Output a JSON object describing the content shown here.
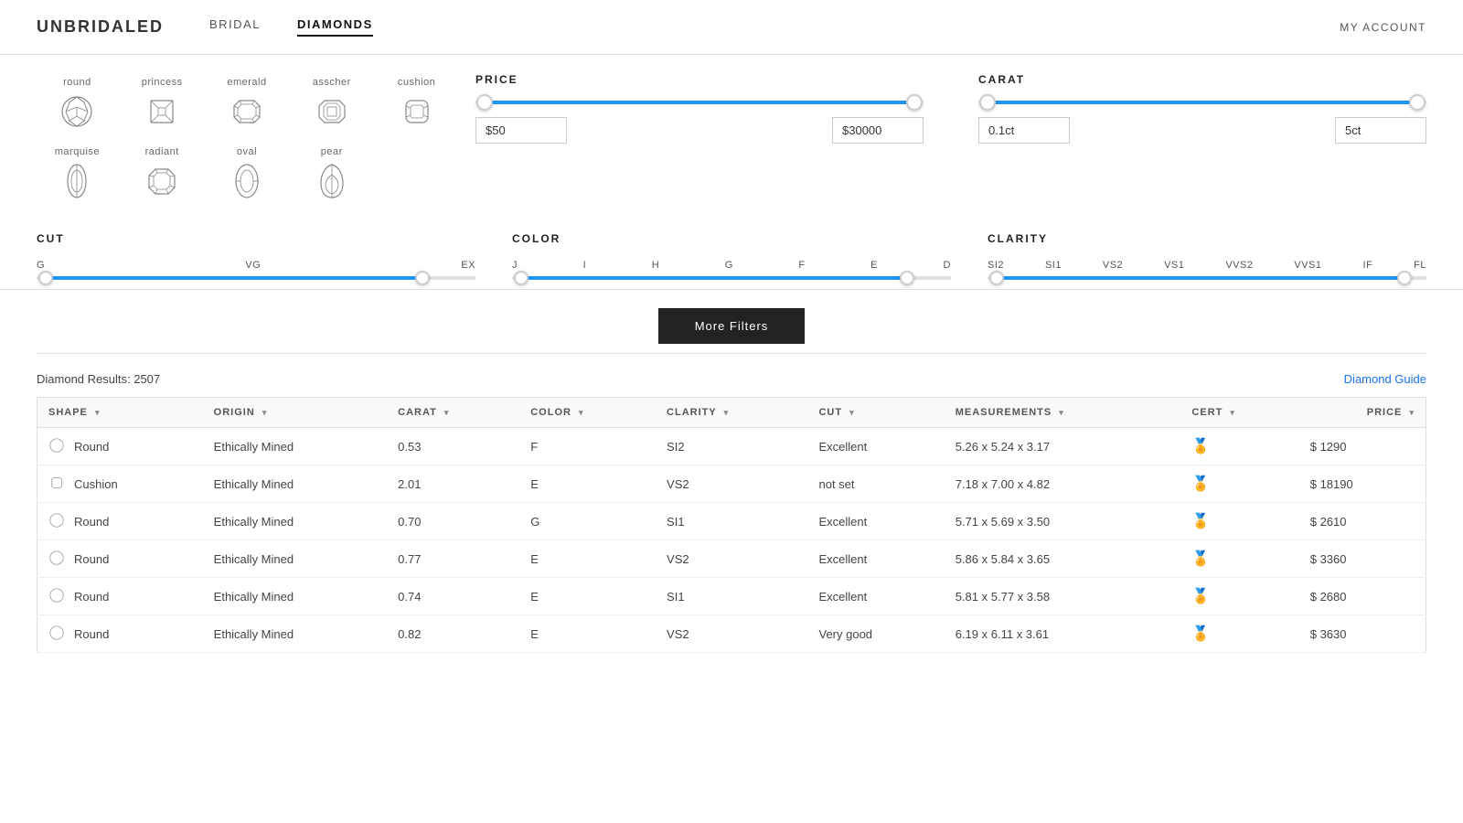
{
  "header": {
    "logo": "UNBRIDALED",
    "nav": [
      {
        "label": "BRIDAL",
        "active": false
      },
      {
        "label": "DIAMONDS",
        "active": true
      }
    ],
    "my_account": "MY ACCOUNT"
  },
  "shapes": [
    {
      "label": "round",
      "id": "round"
    },
    {
      "label": "princess",
      "id": "princess"
    },
    {
      "label": "emerald",
      "id": "emerald"
    },
    {
      "label": "asscher",
      "id": "asscher"
    },
    {
      "label": "cushion",
      "id": "cushion"
    },
    {
      "label": "marquise",
      "id": "marquise"
    },
    {
      "label": "radiant",
      "id": "radiant"
    },
    {
      "label": "oval",
      "id": "oval"
    },
    {
      "label": "pear",
      "id": "pear"
    }
  ],
  "price_filter": {
    "title": "PRICE",
    "min_value": "$50",
    "max_value": "$30000",
    "fill_left": "2%",
    "fill_right": "2%",
    "thumb_left_pct": 2,
    "thumb_right_pct": 98
  },
  "carat_filter": {
    "title": "CARAT",
    "min_value": "0.1ct",
    "max_value": "5ct",
    "fill_left": "2%",
    "fill_right": "2%",
    "thumb_left_pct": 2,
    "thumb_right_pct": 98
  },
  "cut_filter": {
    "title": "CUT",
    "labels": [
      "G",
      "VG",
      "EX"
    ],
    "thumb_left_pct": 2,
    "thumb_right_pct": 88
  },
  "color_filter": {
    "title": "COLOR",
    "labels": [
      "J",
      "I",
      "H",
      "G",
      "F",
      "E",
      "D"
    ],
    "thumb_left_pct": 2,
    "thumb_right_pct": 90
  },
  "clarity_filter": {
    "title": "CLARITY",
    "labels": [
      "SI2",
      "SI1",
      "VS2",
      "VS1",
      "VVS2",
      "VVS1",
      "IF",
      "FL"
    ],
    "thumb_left_pct": 2,
    "thumb_right_pct": 95
  },
  "more_filters_btn": "More Filters",
  "results": {
    "count_label": "Diamond Results: 2507",
    "guide_label": "Diamond Guide",
    "columns": [
      {
        "label": "SHAPE",
        "key": "shape"
      },
      {
        "label": "ORIGIN",
        "key": "origin"
      },
      {
        "label": "CARAT",
        "key": "carat"
      },
      {
        "label": "COLOR",
        "key": "color"
      },
      {
        "label": "CLARITY",
        "key": "clarity"
      },
      {
        "label": "CUT",
        "key": "cut"
      },
      {
        "label": "MEASUREMENTS",
        "key": "measurements"
      },
      {
        "label": "CERT",
        "key": "cert"
      },
      {
        "label": "PRICE",
        "key": "price"
      }
    ],
    "rows": [
      {
        "shape": "Round",
        "shape_id": "round",
        "origin": "Ethically Mined",
        "carat": "0.53",
        "color": "F",
        "clarity": "SI2",
        "cut": "Excellent",
        "measurements": "5.26 x 5.24 x 3.17",
        "price": "$ 1290"
      },
      {
        "shape": "Cushion",
        "shape_id": "cushion",
        "origin": "Ethically Mined",
        "carat": "2.01",
        "color": "E",
        "clarity": "VS2",
        "cut": "not set",
        "measurements": "7.18 x 7.00 x 4.82",
        "price": "$ 18190"
      },
      {
        "shape": "Round",
        "shape_id": "round",
        "origin": "Ethically Mined",
        "carat": "0.70",
        "color": "G",
        "clarity": "SI1",
        "cut": "Excellent",
        "measurements": "5.71 x 5.69 x 3.50",
        "price": "$ 2610"
      },
      {
        "shape": "Round",
        "shape_id": "round",
        "origin": "Ethically Mined",
        "carat": "0.77",
        "color": "E",
        "clarity": "VS2",
        "cut": "Excellent",
        "measurements": "5.86 x 5.84 x 3.65",
        "price": "$ 3360"
      },
      {
        "shape": "Round",
        "shape_id": "round",
        "origin": "Ethically Mined",
        "carat": "0.74",
        "color": "E",
        "clarity": "SI1",
        "cut": "Excellent",
        "measurements": "5.81 x 5.77 x 3.58",
        "price": "$ 2680"
      },
      {
        "shape": "Round",
        "shape_id": "round",
        "origin": "Ethically Mined",
        "carat": "0.82",
        "color": "E",
        "clarity": "VS2",
        "cut": "Very good",
        "measurements": "6.19 x 6.11 x 3.61",
        "price": "$ 3630"
      }
    ]
  }
}
